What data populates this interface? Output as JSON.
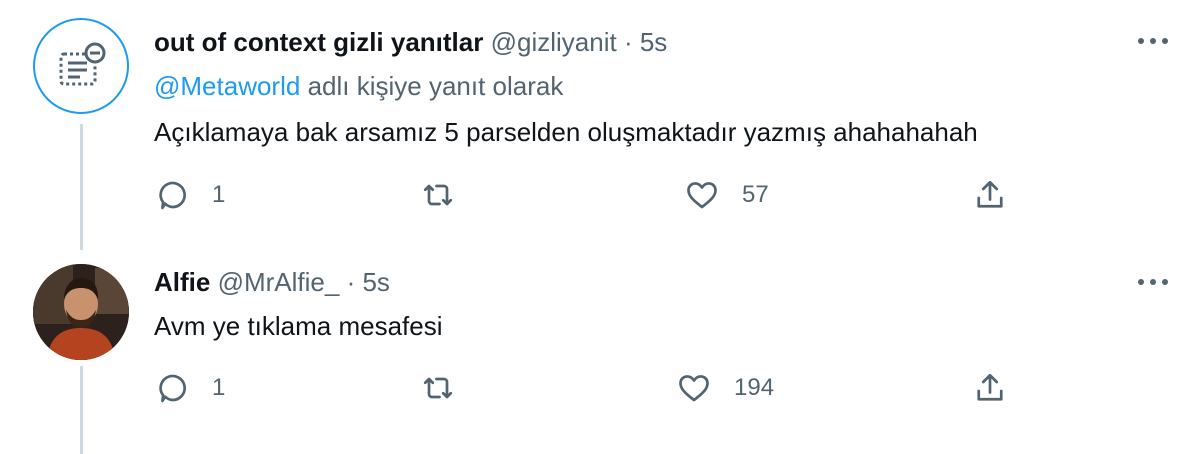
{
  "tweets": [
    {
      "name": "out of context gizli yanıtlar",
      "handle": "@gizliyanit",
      "separator": "·",
      "time": "5s",
      "reply_mention": "@Metaworld",
      "reply_suffix": "adlı kişiye yanıt olarak",
      "text": "Açıklamaya bak arsamız 5 parselden oluşmaktadır yazmış ahahahahah",
      "replies": "1",
      "likes": "57"
    },
    {
      "name": "Alfie",
      "handle": "@MrAlfie_",
      "separator": "·",
      "time": "5s",
      "text": "Avm ye tıklama mesafesi",
      "replies": "1",
      "likes": "194"
    }
  ],
  "icons": {
    "reply": "reply-icon",
    "retweet": "retweet-icon",
    "like": "heart-icon",
    "share": "share-icon",
    "more": "more-options-icon"
  },
  "colors": {
    "accent": "#1d9bf0",
    "secondary_text": "#536471",
    "thread_line": "#cfd9de"
  }
}
